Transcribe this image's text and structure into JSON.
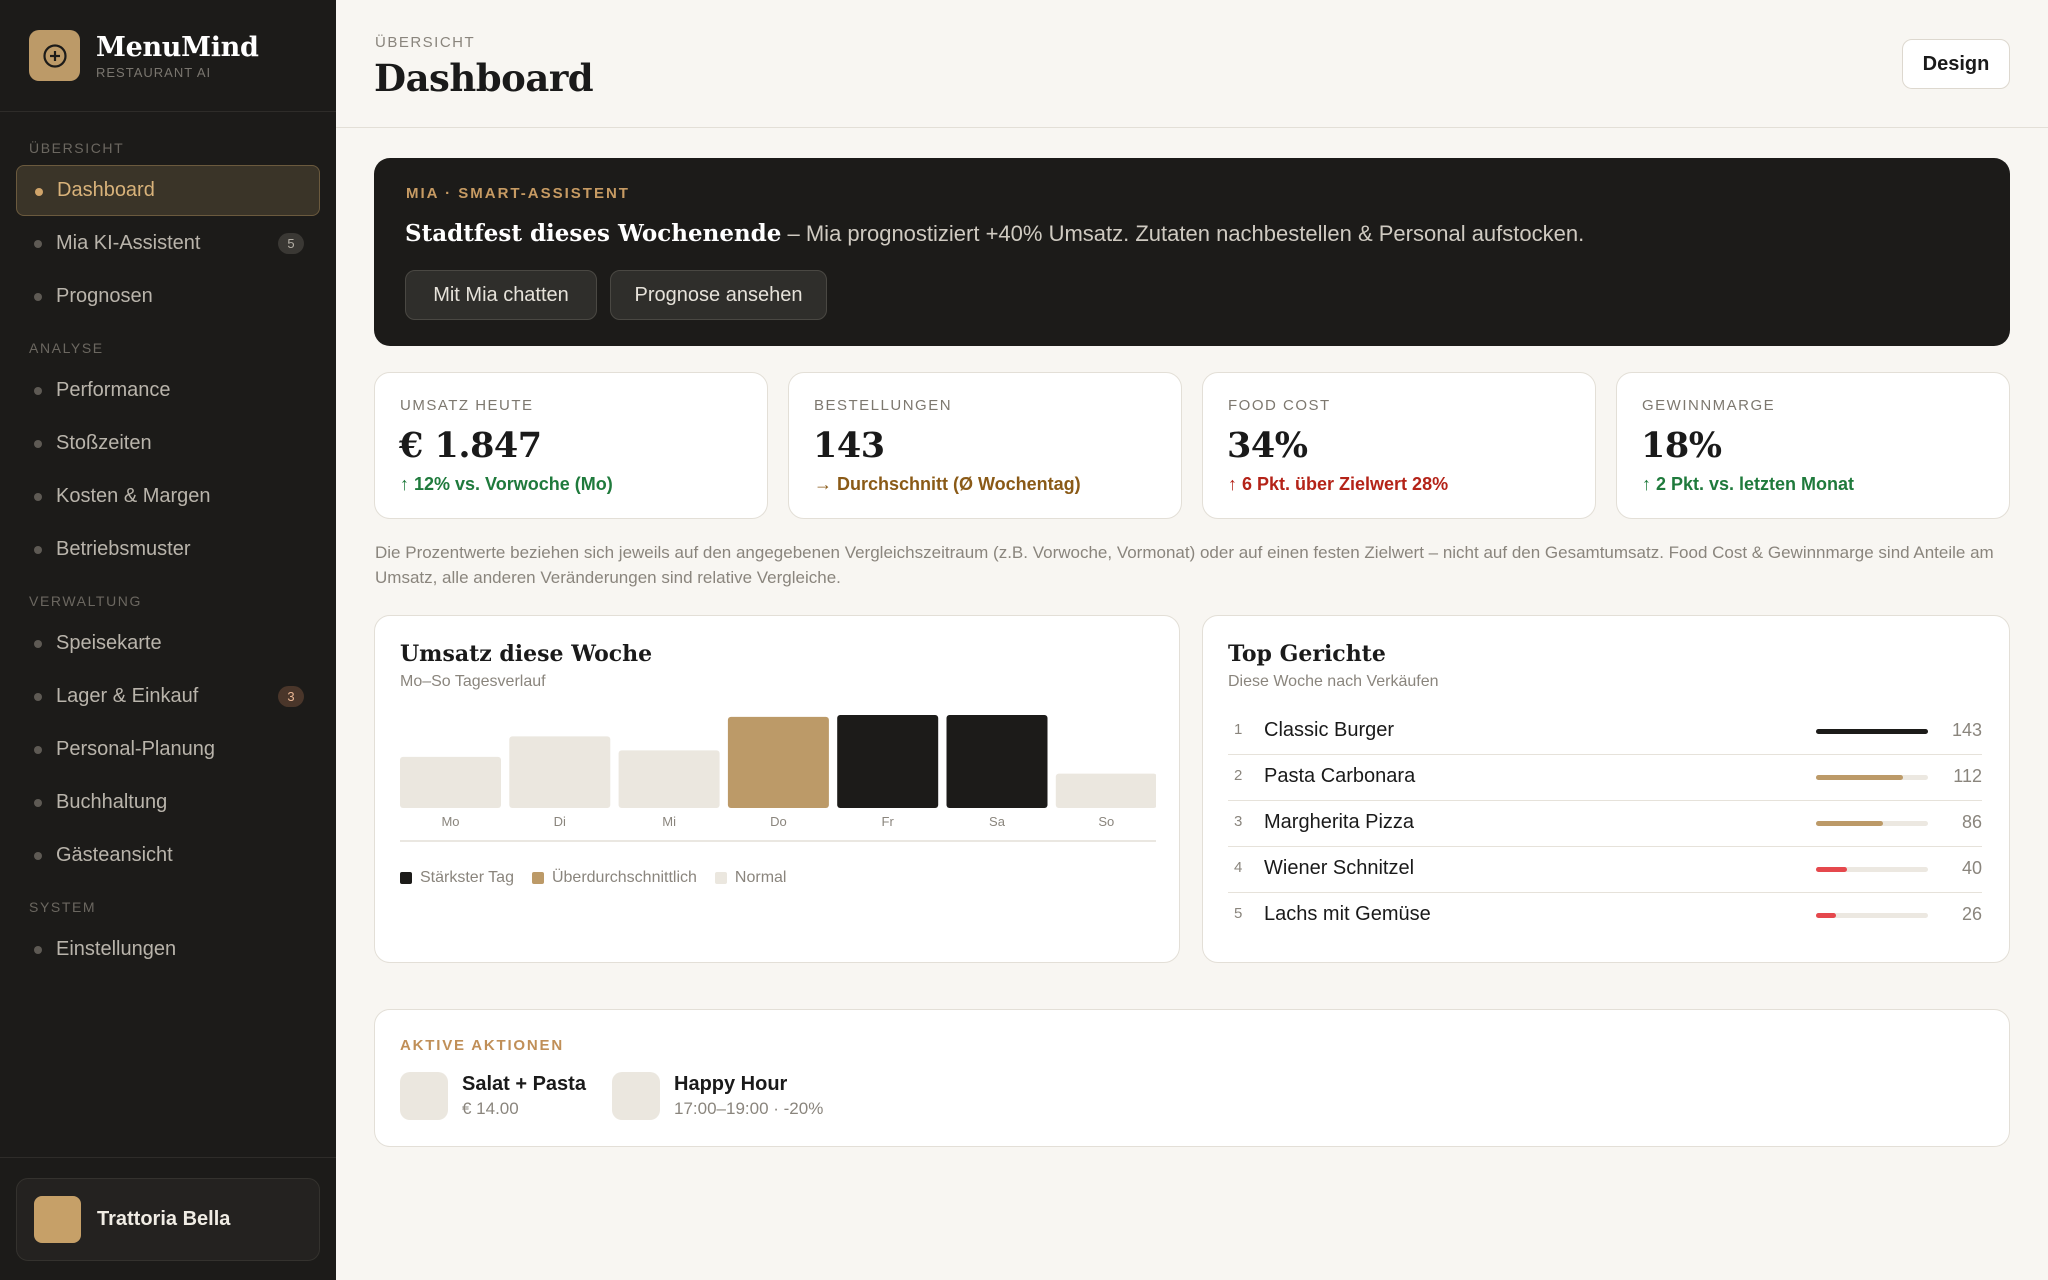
{
  "brand": {
    "name": "MenuMind",
    "subtitle": "RESTAURANT AI"
  },
  "nav": {
    "sections": [
      {
        "label": "ÜBERSICHT",
        "items": [
          {
            "label": "Dashboard",
            "active": true
          },
          {
            "label": "Mia KI-Assistent",
            "badge": "5"
          },
          {
            "label": "Prognosen"
          }
        ]
      },
      {
        "label": "ANALYSE",
        "items": [
          {
            "label": "Performance"
          },
          {
            "label": "Stoßzeiten"
          },
          {
            "label": "Kosten & Margen"
          },
          {
            "label": "Betriebsmuster"
          }
        ]
      },
      {
        "label": "VERWALTUNG",
        "items": [
          {
            "label": "Speisekarte"
          },
          {
            "label": "Lager & Einkauf",
            "badge": "3"
          },
          {
            "label": "Personal-Planung"
          },
          {
            "label": "Buchhaltung"
          },
          {
            "label": "Gästeansicht"
          }
        ]
      },
      {
        "label": "SYSTEM",
        "items": [
          {
            "label": "Einstellungen"
          }
        ]
      }
    ]
  },
  "restaurant": {
    "name": "Trattoria Bella"
  },
  "header": {
    "breadcrumb": "ÜBERSICHT",
    "title": "Dashboard",
    "design_button": "Design"
  },
  "mia": {
    "tag": "MIA · SMART-ASSISTENT",
    "headline": "Stadtfest dieses Wochenende",
    "message": " – Mia prognostiziert +40% Umsatz. Zutaten nachbestellen & Personal aufstocken.",
    "chat_button": "Mit Mia chatten",
    "forecast_button": "Prognose ansehen"
  },
  "kpis": [
    {
      "label": "UMSATZ HEUTE",
      "value": "€ 1.847",
      "delta": "↑ 12% vs. Vorwoche (Mo)",
      "tone": "positive"
    },
    {
      "label": "BESTELLUNGEN",
      "value": "143",
      "delta": "→ Durchschnitt (Ø Wochentag)",
      "tone": "neutral"
    },
    {
      "label": "FOOD COST",
      "value": "34%",
      "delta": "↑ 6 Pkt. über Zielwert 28%",
      "tone": "negative"
    },
    {
      "label": "GEWINNMARGE",
      "value": "18%",
      "delta": "↑ 2 Pkt. vs. letzten Monat",
      "tone": "positive"
    }
  ],
  "colors": {
    "positive": "#1f7a3c",
    "neutral": "#8a5a17",
    "negative": "#b42318",
    "accent": "#bc9a68",
    "strong": "#1c1b19",
    "normal": "#ebe7df",
    "low": "#e5484d"
  },
  "note": "Die Prozentwerte beziehen sich jeweils auf den angegebenen Vergleichszeitraum (z.B. Vorwoche, Vormonat) oder auf einen festen Zielwert – nicht auf den Gesamtumsatz. Food Cost & Gewinnmarge sind Anteile am Umsatz, alle anderen Veränderungen sind relative Vergleiche.",
  "weekly": {
    "title": "Umsatz diese Woche",
    "subtitle": "Mo–So Tagesverlauf",
    "legend": [
      "Stärkster Tag",
      "Überdurchschnittlich",
      "Normal"
    ]
  },
  "chart_data": {
    "type": "bar",
    "categories": [
      "Mo",
      "Di",
      "Mi",
      "Do",
      "Fr",
      "Sa",
      "So"
    ],
    "values": [
      55,
      77,
      62,
      98,
      100,
      100,
      37
    ],
    "levels": [
      "normal",
      "normal",
      "normal",
      "above",
      "strongest",
      "strongest",
      "normal"
    ],
    "ylim": [
      0,
      100
    ],
    "legend": [
      "Stärkster Tag",
      "Überdurchschnittlich",
      "Normal"
    ]
  },
  "top_dishes": {
    "title": "Top Gerichte",
    "subtitle": "Diese Woche nach Verkäufen",
    "items": [
      {
        "rank": "1",
        "name": "Classic Burger",
        "count": "143",
        "share": 1.0,
        "color": "#1c1b19"
      },
      {
        "rank": "2",
        "name": "Pasta Carbonara",
        "count": "112",
        "share": 0.78,
        "color": "#bc9a68"
      },
      {
        "rank": "3",
        "name": "Margherita Pizza",
        "count": "86",
        "share": 0.6,
        "color": "#bc9a68"
      },
      {
        "rank": "4",
        "name": "Wiener Schnitzel",
        "count": "40",
        "share": 0.28,
        "color": "#e5484d"
      },
      {
        "rank": "5",
        "name": "Lachs mit Gemüse",
        "count": "26",
        "share": 0.18,
        "color": "#e5484d"
      }
    ]
  },
  "actions": {
    "label": "AKTIVE AKTIONEN",
    "items": [
      {
        "title": "Salat + Pasta",
        "sub": "€ 14.00"
      },
      {
        "title": "Happy Hour",
        "sub": "17:00–19:00 · -20%"
      }
    ]
  }
}
